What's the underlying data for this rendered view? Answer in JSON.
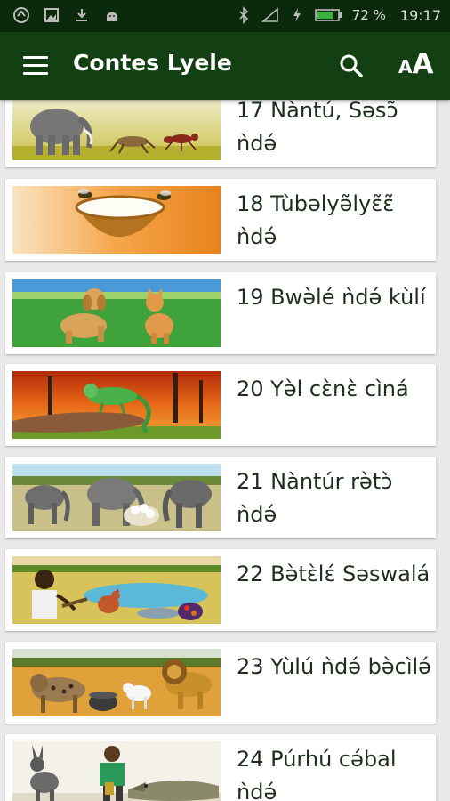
{
  "status": {
    "battery_percent": "72 %",
    "time": "19:17"
  },
  "appbar": {
    "title": "Contes Lyele",
    "icons": [
      "menu-icon",
      "search-icon",
      "text-size-icon"
    ]
  },
  "stories": [
    {
      "title": "17 Nàntú, Səsɔ̃ ǹdə́"
    },
    {
      "title": "18 Tùbəlyə̃lyɛ̃ɛ̃ ǹdə́"
    },
    {
      "title": "19 Bwə̀lé ǹdə́ kùlí"
    },
    {
      "title": "20 Yə̀l cɛ̀nɛ̀ cìná"
    },
    {
      "title": "21 Nàntúr rə̀tɔ̀ ǹdə́"
    },
    {
      "title": "22 Bə̀tɛ̀lɛ́ Səswalá"
    },
    {
      "title": "23 Yùlú ǹdə́ bə̀cìlə́"
    },
    {
      "title": "24 Púrhú cə́bal ǹdə́"
    }
  ]
}
